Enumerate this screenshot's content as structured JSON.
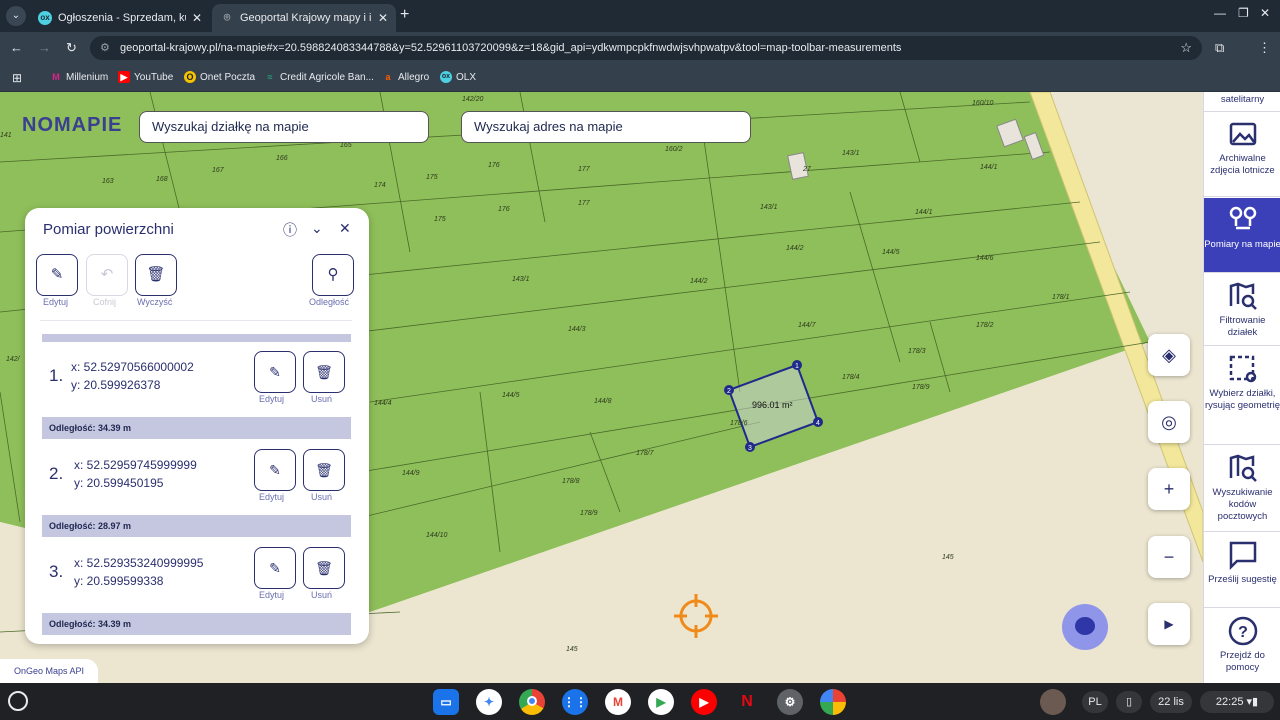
{
  "browser": {
    "tabs": [
      {
        "title": "Ogłoszenia - Sprzedam, kupię n",
        "active": false
      },
      {
        "title": "Geoportal Krajowy mapy i infor",
        "active": true
      }
    ],
    "url": "geoportal-krajowy.pl/na-mapie#x=20.598824083344788&y=52.52961103720099&z=18&gid_api=ydkwmpcpkfnwdwjsvhpwatpv&tool=map-toolbar-measurements",
    "bookmarks": [
      "Millenium",
      "YouTube",
      "Onet Poczta",
      "Credit Agricole Ban...",
      "Allegro",
      "OLX"
    ]
  },
  "map": {
    "logo": "NOMAPIE",
    "search_parcel": "Wyszukaj działkę na mapie",
    "search_address": "Wyszukaj adres na mapie",
    "area_label": "996.01 m²",
    "api_credit": "OnGeo Maps API",
    "parcel_labels": [
      "142/20",
      "160/10",
      "165",
      "166",
      "167",
      "163",
      "168",
      "174",
      "175",
      "176",
      "177",
      "160/2",
      "143/1",
      "144/1",
      "27",
      "175",
      "176",
      "177",
      "143/1",
      "144/1",
      "144/2",
      "144/5",
      "144/6",
      "143/1",
      "144/2",
      "144/7",
      "178/1",
      "178/2",
      "144/3",
      "178/3",
      "178/4",
      "144/5",
      "144/8",
      "178/9",
      "144/4",
      "178/7",
      "144/9",
      "178/8",
      "178/9",
      "144/10",
      "145",
      "145",
      "178/6",
      "142/",
      "141"
    ]
  },
  "panel": {
    "title": "Pomiar powierzchni",
    "tools": {
      "edit": "Edytuj",
      "undo": "Cofnij",
      "clear": "Wyczyść",
      "distance": "Odległość"
    },
    "points": [
      {
        "num": "1.",
        "x": "x: 52.52970566000002",
        "y": "y: 20.599926378",
        "edit": "Edytuj",
        "delete": "Usuń",
        "distance": "Odległość: 34.39 m"
      },
      {
        "num": "2.",
        "x": "x: 52.52959745999999",
        "y": "y: 20.599450195",
        "edit": "Edytuj",
        "delete": "Usuń",
        "distance": "Odległość: 28.97 m"
      },
      {
        "num": "3.",
        "x": "x: 52.529353240999995",
        "y": "y: 20.599599338",
        "edit": "Edytuj",
        "delete": "Usuń",
        "distance": "Odległość: 34.39 m"
      }
    ]
  },
  "sidebar": {
    "items": [
      {
        "label": "satelitarny"
      },
      {
        "label": "Archiwalne zdjęcia lotnicze"
      },
      {
        "label": "Pomiary na mapie"
      },
      {
        "label": "Filtrowanie działek"
      },
      {
        "label": "Wybierz działki, rysując geometrię"
      },
      {
        "label": "Wyszukiwanie kodów pocztowych"
      },
      {
        "label": "Prześlij sugestię"
      },
      {
        "label": "Przejdź do pomocy"
      }
    ]
  },
  "taskbar": {
    "lang": "PL",
    "date": "22 lis",
    "time": "22:25"
  },
  "colors": {
    "accent": "#3b40b8",
    "parcel_green": "#8dc05a",
    "measure": "#1f2a8a"
  }
}
